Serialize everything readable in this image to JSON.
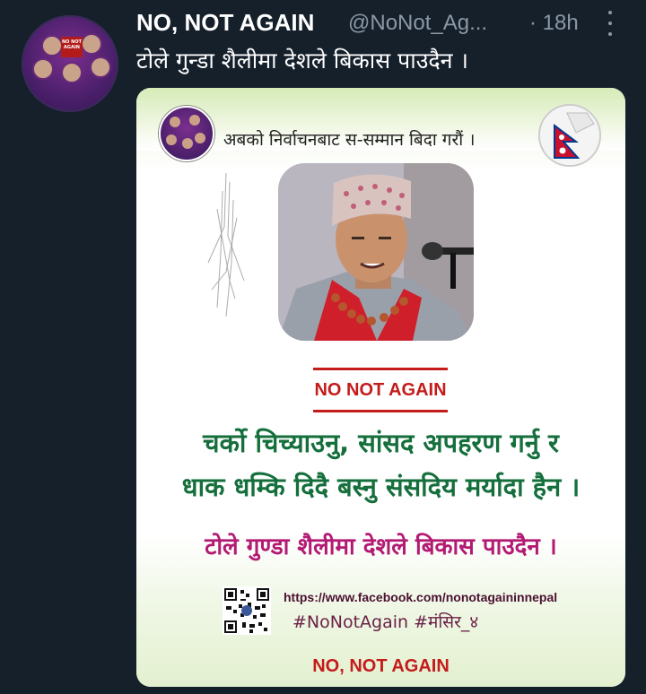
{
  "tweet": {
    "author_name": "NO, NOT AGAIN",
    "handle": "@NoNot_Ag...",
    "time": "· 18h",
    "text": "टोले गुन्डा शैलीमा देशले बिकास पाउदैन ।"
  },
  "avatar": {
    "badge": "NO NOT AGAIN"
  },
  "card": {
    "farewell": "अबको निर्वाचनबाट स-सम्मान बिदा गरौं ।",
    "no_not_again_box": "NO NOT AGAIN",
    "line1": "चर्को चिच्याउनु, सांसद अपहरण गर्नु र",
    "line2": "धाक धम्कि दिदै बस्नु संसदिय मर्यादा हैन ।",
    "line3": "टोले गुण्डा शैलीमा देशले बिकास पाउदैन ।",
    "url": "https://www.facebook.com/nonotagaininnepal",
    "hashtags": "#NoNotAgain #मंसिर_४",
    "footer": "NO, NOT AGAIN"
  },
  "colors": {
    "background": "#15202b",
    "heading_red": "#c41b1b",
    "green_text": "#156f3c",
    "magenta_text": "#b31a73"
  }
}
